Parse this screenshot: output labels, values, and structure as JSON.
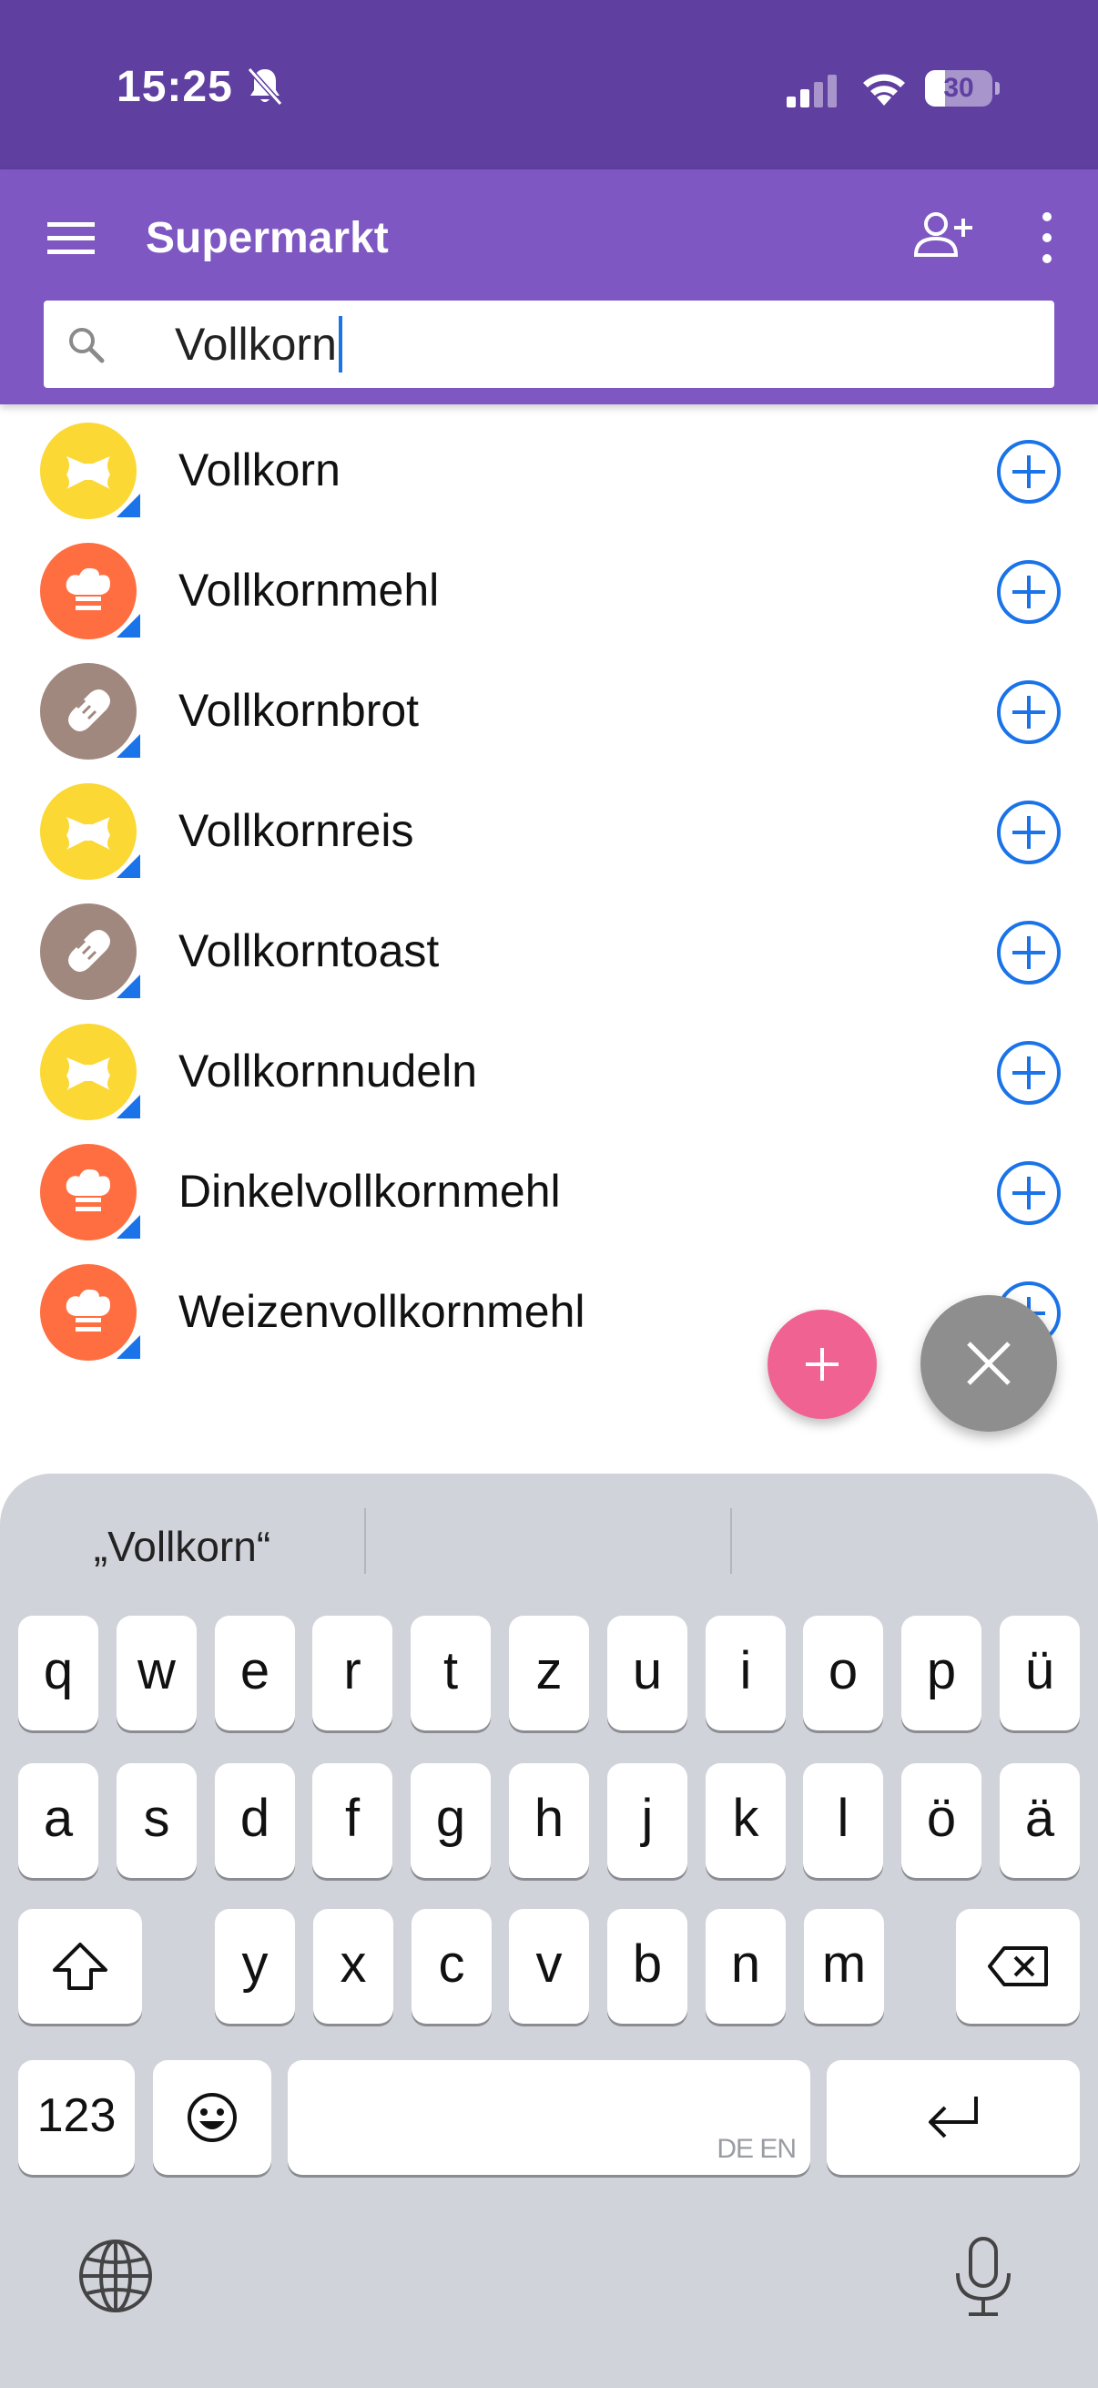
{
  "status_bar": {
    "time": "15:25",
    "battery_level": "30",
    "battery_fraction": 0.3
  },
  "app_bar": {
    "title": "Supermarkt",
    "search_value": "Vollkorn"
  },
  "colors": {
    "primary": "#7e57c2",
    "status": "#5f3fa0",
    "accent_blue": "#1a73e8",
    "fab_pink": "#f06292",
    "cat_pasta": "#fbd834",
    "cat_baking": "#ff6e40",
    "cat_bread": "#a1887f"
  },
  "items": [
    {
      "label": "Vollkorn",
      "category": "pasta-icon"
    },
    {
      "label": "Vollkornmehl",
      "category": "chef-hat-icon"
    },
    {
      "label": "Vollkornbrot",
      "category": "bread-icon"
    },
    {
      "label": "Vollkornreis",
      "category": "pasta-icon"
    },
    {
      "label": "Vollkorntoast",
      "category": "bread-icon"
    },
    {
      "label": "Vollkornnudeln",
      "category": "pasta-icon"
    },
    {
      "label": "Dinkelvollkornmehl",
      "category": "chef-hat-icon"
    },
    {
      "label": "Weizenvollkornmehl",
      "category": "chef-hat-icon"
    }
  ],
  "keyboard": {
    "suggestions": [
      "„Vollkorn“",
      "",
      ""
    ],
    "row1": [
      "q",
      "w",
      "e",
      "r",
      "t",
      "z",
      "u",
      "i",
      "o",
      "p",
      "ü"
    ],
    "row2": [
      "a",
      "s",
      "d",
      "f",
      "g",
      "h",
      "j",
      "k",
      "l",
      "ö",
      "ä"
    ],
    "row3": [
      "y",
      "x",
      "c",
      "v",
      "b",
      "n",
      "m"
    ],
    "numbers_key": "123",
    "space_lang": "DE EN"
  }
}
